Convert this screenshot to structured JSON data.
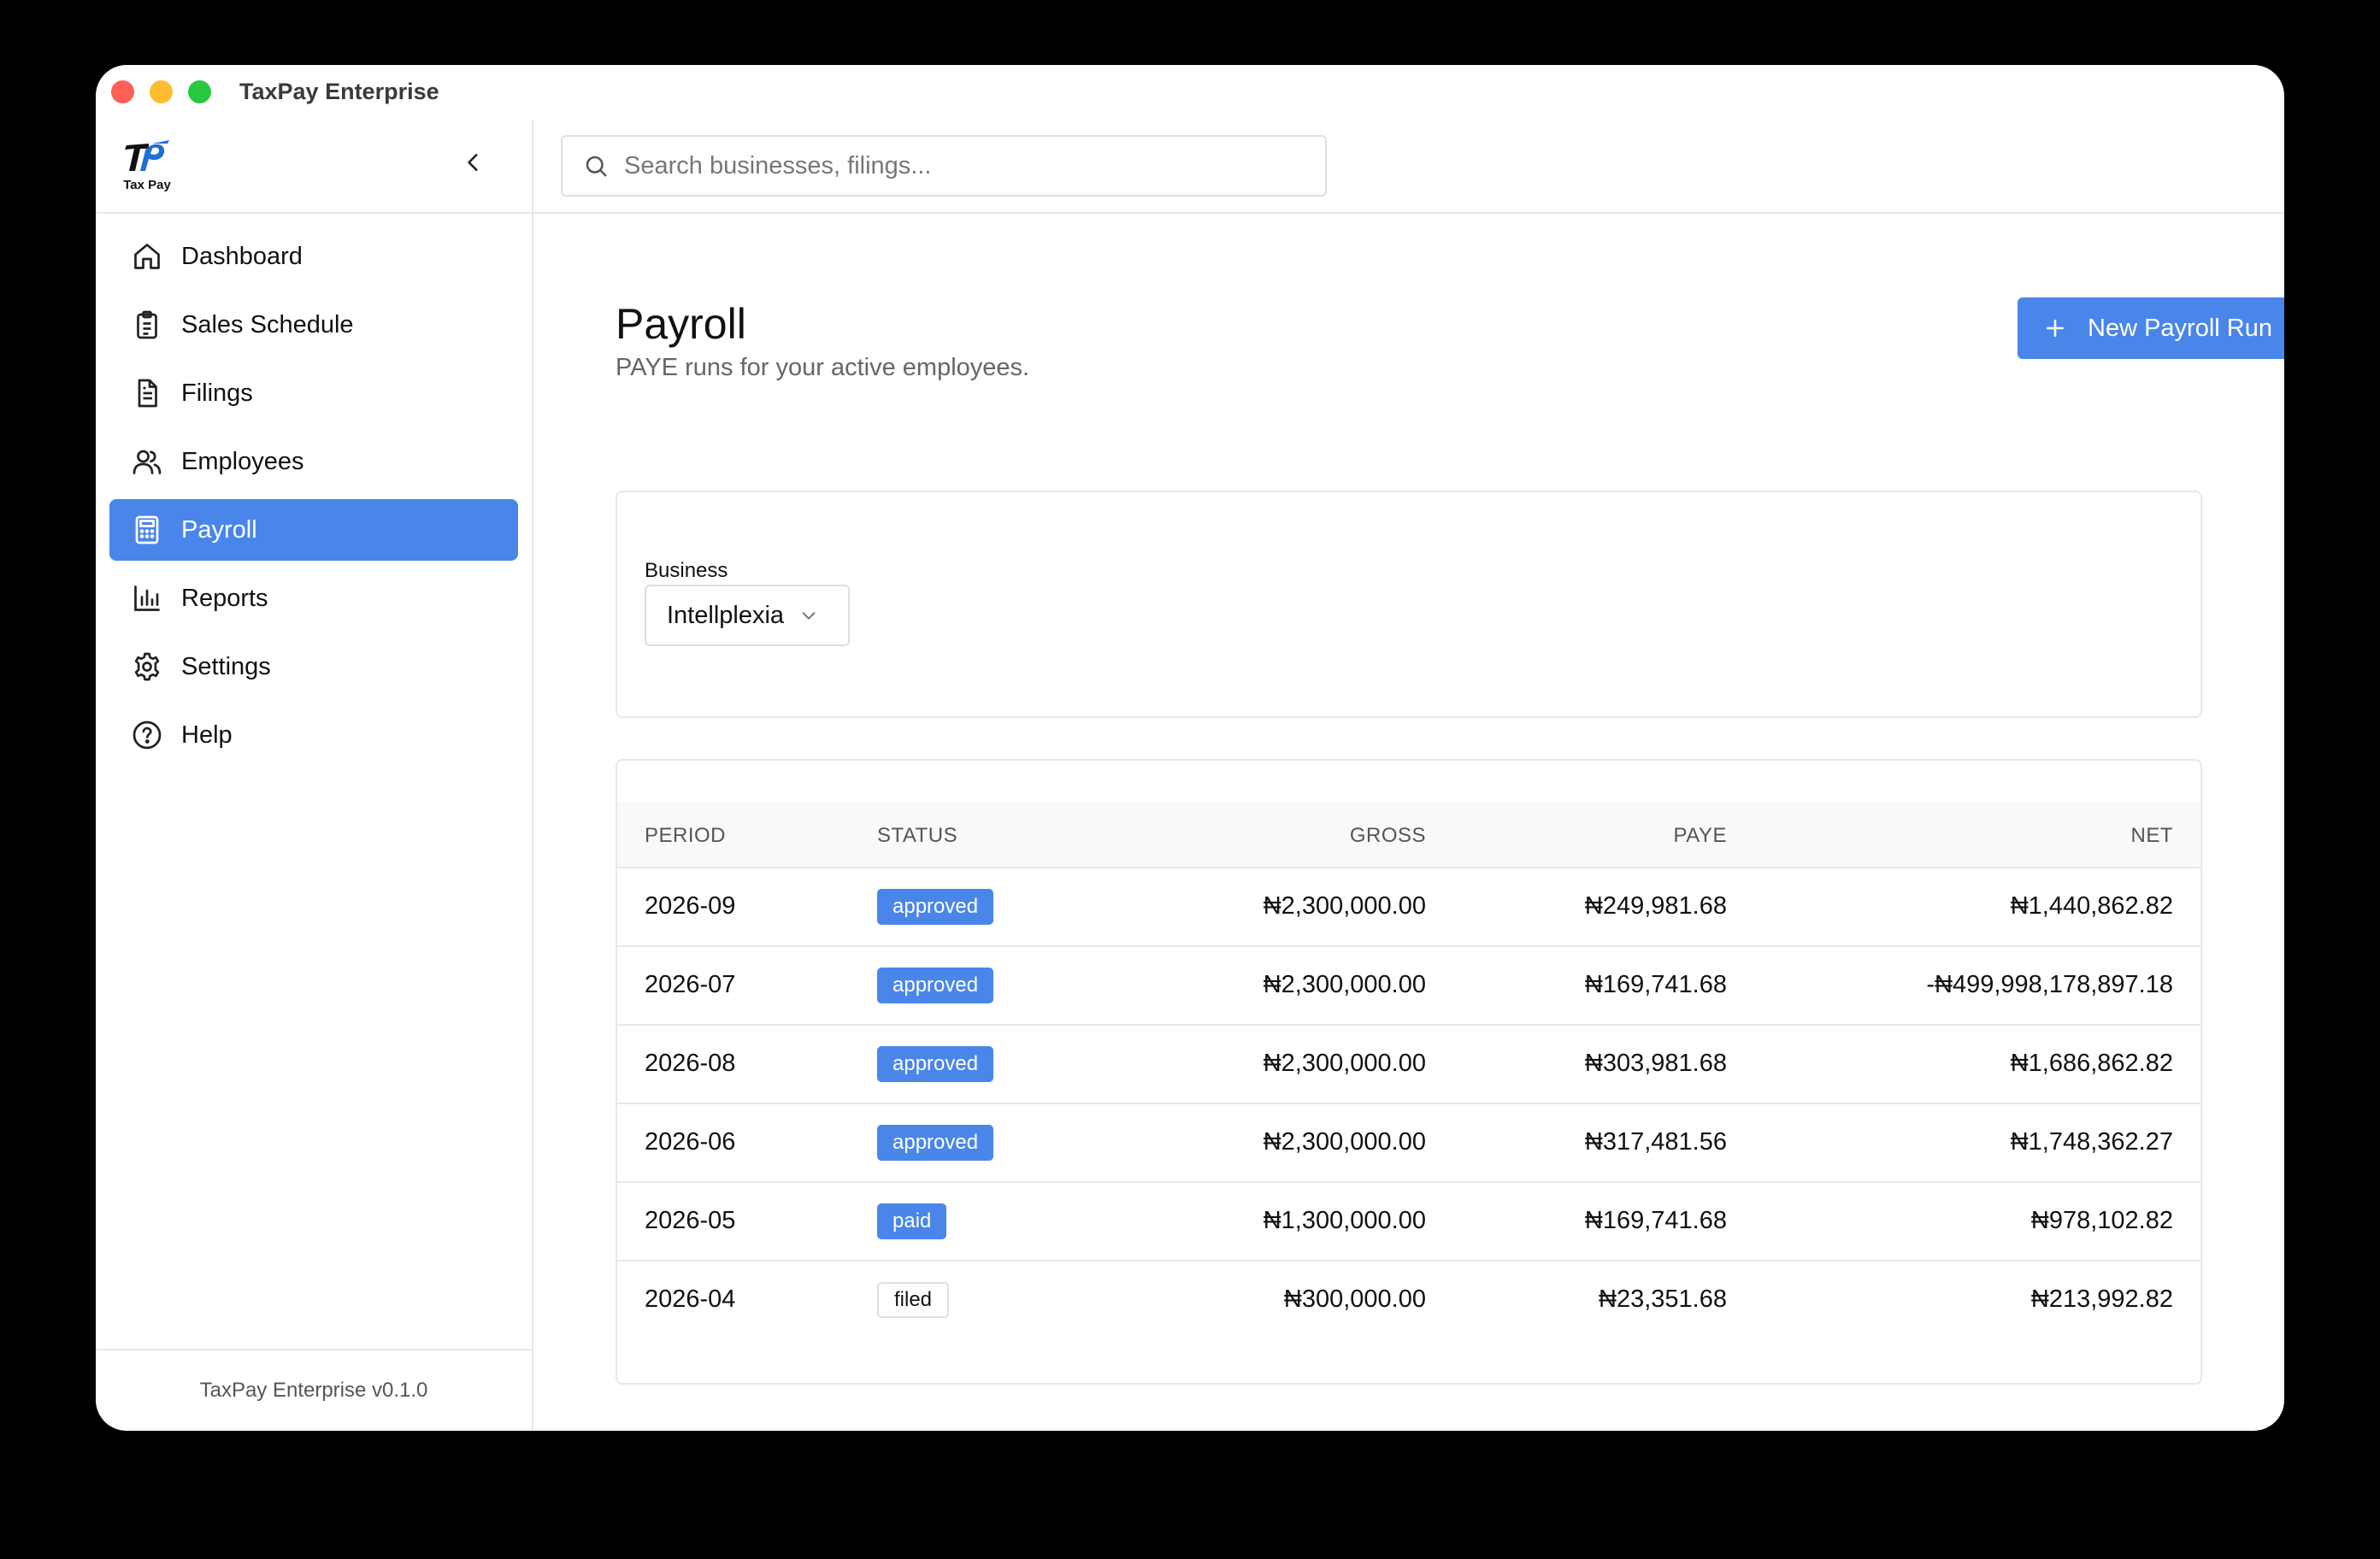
{
  "window": {
    "title": "TaxPay Enterprise"
  },
  "sidebar": {
    "logo_text": "Tax Pay",
    "items": [
      {
        "label": "Dashboard",
        "icon": "home-icon",
        "active": false
      },
      {
        "label": "Sales Schedule",
        "icon": "clipboard-icon",
        "active": false
      },
      {
        "label": "Filings",
        "icon": "document-icon",
        "active": false
      },
      {
        "label": "Employees",
        "icon": "users-icon",
        "active": false
      },
      {
        "label": "Payroll",
        "icon": "calculator-icon",
        "active": true
      },
      {
        "label": "Reports",
        "icon": "bar-chart-icon",
        "active": false
      },
      {
        "label": "Settings",
        "icon": "gear-icon",
        "active": false
      },
      {
        "label": "Help",
        "icon": "help-circle-icon",
        "active": false
      }
    ],
    "footer": "TaxPay Enterprise v0.1.0"
  },
  "search": {
    "placeholder": "Search businesses, filings...",
    "value": ""
  },
  "page": {
    "title": "Payroll",
    "subtitle": "PAYE runs for your active employees.",
    "new_button_label": "New Payroll Run"
  },
  "filter": {
    "label": "Business",
    "selected": "Intellplexia"
  },
  "table": {
    "headers": {
      "period": "PERIOD",
      "status": "STATUS",
      "gross": "GROSS",
      "paye": "PAYE",
      "net": "NET"
    },
    "rows": [
      {
        "period": "2026-09",
        "status": "approved",
        "gross": "₦2,300,000.00",
        "paye": "₦249,981.68",
        "net": "₦1,440,862.82"
      },
      {
        "period": "2026-07",
        "status": "approved",
        "gross": "₦2,300,000.00",
        "paye": "₦169,741.68",
        "net": "-₦499,998,178,897.18"
      },
      {
        "period": "2026-08",
        "status": "approved",
        "gross": "₦2,300,000.00",
        "paye": "₦303,981.68",
        "net": "₦1,686,862.82"
      },
      {
        "period": "2026-06",
        "status": "approved",
        "gross": "₦2,300,000.00",
        "paye": "₦317,481.56",
        "net": "₦1,748,362.27"
      },
      {
        "period": "2026-05",
        "status": "paid",
        "gross": "₦1,300,000.00",
        "paye": "₦169,741.68",
        "net": "₦978,102.82"
      },
      {
        "period": "2026-04",
        "status": "filed",
        "gross": "₦300,000.00",
        "paye": "₦23,351.68",
        "net": "₦213,992.82"
      }
    ]
  },
  "colors": {
    "accent": "#4a86ea",
    "border": "#e6e8ec",
    "background": "#ffffff"
  }
}
